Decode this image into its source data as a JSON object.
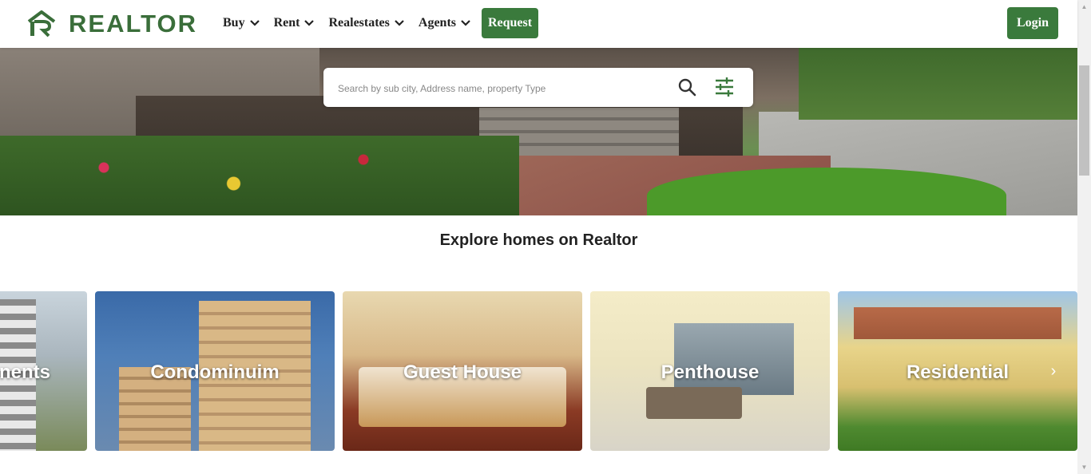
{
  "header": {
    "brand": "REALTOR",
    "nav": [
      {
        "label": "Buy"
      },
      {
        "label": "Rent"
      },
      {
        "label": "Realestates"
      },
      {
        "label": "Agents"
      }
    ],
    "request_label": "Request",
    "login_label": "Login"
  },
  "search": {
    "placeholder": "Search by sub city, Address name, property Type"
  },
  "section": {
    "title": "Explore homes on Realtor"
  },
  "categories": [
    {
      "label": "Apartments",
      "visible_text": "nents"
    },
    {
      "label": "Condominuim"
    },
    {
      "label": "Guest House"
    },
    {
      "label": "Penthouse"
    },
    {
      "label": "Residential"
    }
  ],
  "colors": {
    "brand_green": "#3a7a3c"
  }
}
